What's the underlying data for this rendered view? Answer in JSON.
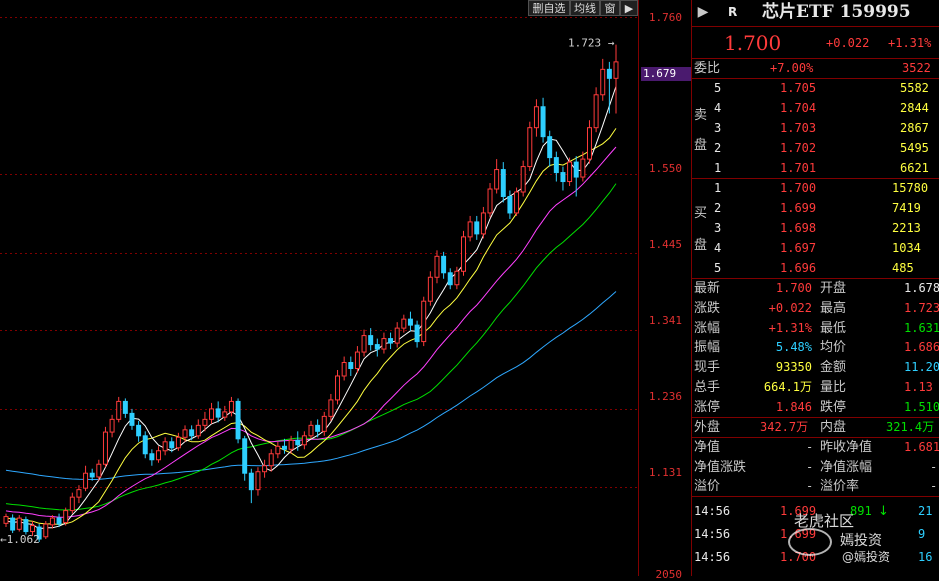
{
  "toolbar": {
    "items": [
      "删自选",
      "均线",
      "窗"
    ],
    "arrow_glyph": "▶"
  },
  "axis": {
    "price_labels": [
      "1.760",
      "1.550",
      "1.445",
      "1.341",
      "1.236",
      "1.131"
    ],
    "bottom_label": "2050",
    "current_price_tag": "1.679",
    "high_label": "1.723",
    "low_label": "1.062"
  },
  "header": {
    "r_badge": "R",
    "title": "芯片ETF 159995",
    "price": "1.700",
    "change": "+0.022",
    "change_pct": "+1.31%"
  },
  "order_book": {
    "weibi_label": "委比",
    "weibi_value": "+7.00%",
    "weibi_diff": "3522",
    "sell_label_top": "卖",
    "sell_label_bottom": "盘",
    "buy_label_top": "买",
    "buy_label_bottom": "盘",
    "sell": [
      {
        "level": "5",
        "price": "1.705",
        "vol": "5582"
      },
      {
        "level": "4",
        "price": "1.704",
        "vol": "2844"
      },
      {
        "level": "3",
        "price": "1.703",
        "vol": "2867"
      },
      {
        "level": "2",
        "price": "1.702",
        "vol": "5495"
      },
      {
        "level": "1",
        "price": "1.701",
        "vol": "6621"
      }
    ],
    "buy": [
      {
        "level": "1",
        "price": "1.700",
        "vol": "15780"
      },
      {
        "level": "2",
        "price": "1.699",
        "vol": "7419"
      },
      {
        "level": "3",
        "price": "1.698",
        "vol": "2213"
      },
      {
        "level": "4",
        "price": "1.697",
        "vol": "1034"
      },
      {
        "level": "5",
        "price": "1.696",
        "vol": "485"
      }
    ]
  },
  "stats": [
    {
      "l1": "最新",
      "v1": "1.700",
      "c1": "red",
      "l2": "开盘",
      "v2": "1.678",
      "c2": "white"
    },
    {
      "l1": "涨跌",
      "v1": "+0.022",
      "c1": "red",
      "l2": "最高",
      "v2": "1.723",
      "c2": "red"
    },
    {
      "l1": "涨幅",
      "v1": "+1.31%",
      "c1": "red",
      "l2": "最低",
      "v2": "1.631",
      "c2": "green"
    },
    {
      "l1": "振幅",
      "v1": "5.48%",
      "c1": "cyan",
      "l2": "均价",
      "v2": "1.686",
      "c2": "red"
    },
    {
      "l1": "现手",
      "v1": "93350",
      "c1": "yellow",
      "l2": "金额",
      "v2": "11.20亿",
      "c2": "cyan"
    },
    {
      "l1": "总手",
      "v1": "664.1万",
      "c1": "yellow",
      "l2": "量比",
      "v2": "1.13",
      "c2": "red"
    },
    {
      "l1": "涨停",
      "v1": "1.846",
      "c1": "red",
      "l2": "跌停",
      "v2": "1.510",
      "c2": "green"
    }
  ],
  "flow": {
    "out_label": "外盘",
    "out_value": "342.7万",
    "in_label": "内盘",
    "in_value": "321.4万"
  },
  "nav": [
    {
      "l1": "净值",
      "v1": "-",
      "l2": "昨收净值",
      "v2": "1.681"
    },
    {
      "l1": "净值涨跌",
      "v1": "-",
      "l2": "净值涨幅",
      "v2": "-"
    },
    {
      "l1": "溢价",
      "v1": "-",
      "l2": "溢价率",
      "v2": "-"
    }
  ],
  "ticks": [
    {
      "time": "14:56",
      "price": "1.699",
      "vol": "891",
      "dir": "↓",
      "extra": "21"
    },
    {
      "time": "14:56",
      "price": "1.699",
      "vol": "",
      "dir": "",
      "extra": "9"
    },
    {
      "time": "14:56",
      "price": "1.700",
      "vol": "",
      "dir": "",
      "extra": "16"
    }
  ],
  "watermark": {
    "line1": "老虎社区",
    "line2": "嫣投资",
    "line3": "@嫣投资"
  },
  "colors": {
    "up": "#ff3b3b",
    "down": "#2ecfff",
    "ma5": "#ffffff",
    "ma10": "#ffff40",
    "ma20": "#ff40ff",
    "ma30": "#00e000",
    "ma60": "#2ea8ff",
    "grid": "#800000"
  },
  "chart_data": {
    "type": "candlestick",
    "ylim": [
      1.05,
      1.76
    ],
    "candles": [
      [
        1.083,
        1.092,
        1.078,
        1.096
      ],
      [
        1.09,
        1.074,
        1.07,
        1.095
      ],
      [
        1.075,
        1.09,
        1.072,
        1.094
      ],
      [
        1.088,
        1.072,
        1.068,
        1.092
      ],
      [
        1.072,
        1.08,
        1.066,
        1.086
      ],
      [
        1.078,
        1.062,
        1.058,
        1.082
      ],
      [
        1.065,
        1.082,
        1.062,
        1.086
      ],
      [
        1.081,
        1.09,
        1.076,
        1.094
      ],
      [
        1.09,
        1.082,
        1.078,
        1.096
      ],
      [
        1.084,
        1.1,
        1.08,
        1.104
      ],
      [
        1.1,
        1.118,
        1.096,
        1.124
      ],
      [
        1.118,
        1.128,
        1.11,
        1.134
      ],
      [
        1.13,
        1.15,
        1.126,
        1.16
      ],
      [
        1.15,
        1.145,
        1.14,
        1.156
      ],
      [
        1.145,
        1.162,
        1.14,
        1.168
      ],
      [
        1.162,
        1.205,
        1.158,
        1.212
      ],
      [
        1.205,
        1.222,
        1.198,
        1.228
      ],
      [
        1.222,
        1.246,
        1.218,
        1.252
      ],
      [
        1.246,
        1.23,
        1.224,
        1.25
      ],
      [
        1.23,
        1.214,
        1.208,
        1.236
      ],
      [
        1.214,
        1.2,
        1.192,
        1.22
      ],
      [
        1.2,
        1.176,
        1.17,
        1.206
      ],
      [
        1.176,
        1.168,
        1.16,
        1.182
      ],
      [
        1.168,
        1.18,
        1.164,
        1.186
      ],
      [
        1.18,
        1.192,
        1.174,
        1.198
      ],
      [
        1.192,
        1.184,
        1.178,
        1.198
      ],
      [
        1.184,
        1.198,
        1.18,
        1.204
      ],
      [
        1.198,
        1.208,
        1.192,
        1.214
      ],
      [
        1.208,
        1.2,
        1.194,
        1.214
      ],
      [
        1.2,
        1.214,
        1.196,
        1.222
      ],
      [
        1.214,
        1.222,
        1.206,
        1.232
      ],
      [
        1.222,
        1.236,
        1.216,
        1.244
      ],
      [
        1.236,
        1.225,
        1.218,
        1.246
      ],
      [
        1.225,
        1.232,
        1.22,
        1.24
      ],
      [
        1.232,
        1.246,
        1.226,
        1.252
      ],
      [
        1.246,
        1.196,
        1.19,
        1.25
      ],
      [
        1.196,
        1.15,
        1.14,
        1.2
      ],
      [
        1.15,
        1.128,
        1.11,
        1.156
      ],
      [
        1.128,
        1.152,
        1.12,
        1.158
      ],
      [
        1.152,
        1.16,
        1.144,
        1.168
      ],
      [
        1.16,
        1.176,
        1.152,
        1.182
      ],
      [
        1.176,
        1.186,
        1.17,
        1.192
      ],
      [
        1.186,
        1.182,
        1.176,
        1.196
      ],
      [
        1.182,
        1.194,
        1.176,
        1.2
      ],
      [
        1.194,
        1.188,
        1.18,
        1.206
      ],
      [
        1.188,
        1.2,
        1.182,
        1.206
      ],
      [
        1.2,
        1.214,
        1.196,
        1.22
      ],
      [
        1.214,
        1.206,
        1.198,
        1.222
      ],
      [
        1.206,
        1.226,
        1.2,
        1.232
      ],
      [
        1.226,
        1.248,
        1.22,
        1.256
      ],
      [
        1.248,
        1.28,
        1.242,
        1.288
      ],
      [
        1.28,
        1.298,
        1.274,
        1.306
      ],
      [
        1.298,
        1.29,
        1.28,
        1.306
      ],
      [
        1.29,
        1.312,
        1.284,
        1.32
      ],
      [
        1.312,
        1.334,
        1.306,
        1.342
      ],
      [
        1.334,
        1.322,
        1.314,
        1.344
      ],
      [
        1.322,
        1.316,
        1.306,
        1.33
      ],
      [
        1.316,
        1.33,
        1.31,
        1.338
      ],
      [
        1.33,
        1.324,
        1.316,
        1.338
      ],
      [
        1.324,
        1.344,
        1.318,
        1.352
      ],
      [
        1.344,
        1.356,
        1.338,
        1.362
      ],
      [
        1.356,
        1.348,
        1.34,
        1.366
      ],
      [
        1.348,
        1.326,
        1.318,
        1.354
      ],
      [
        1.326,
        1.38,
        1.32,
        1.386
      ],
      [
        1.38,
        1.412,
        1.374,
        1.42
      ],
      [
        1.412,
        1.44,
        1.404,
        1.448
      ],
      [
        1.44,
        1.418,
        1.41,
        1.446
      ],
      [
        1.418,
        1.402,
        1.396,
        1.424
      ],
      [
        1.402,
        1.42,
        1.396,
        1.426
      ],
      [
        1.42,
        1.466,
        1.414,
        1.474
      ],
      [
        1.466,
        1.486,
        1.46,
        1.494
      ],
      [
        1.486,
        1.47,
        1.462,
        1.494
      ],
      [
        1.47,
        1.498,
        1.464,
        1.506
      ],
      [
        1.498,
        1.53,
        1.492,
        1.538
      ],
      [
        1.53,
        1.556,
        1.524,
        1.57
      ],
      [
        1.556,
        1.52,
        1.512,
        1.566
      ],
      [
        1.52,
        1.498,
        1.49,
        1.528
      ],
      [
        1.498,
        1.526,
        1.494,
        1.532
      ],
      [
        1.526,
        1.56,
        1.52,
        1.568
      ],
      [
        1.56,
        1.612,
        1.554,
        1.62
      ],
      [
        1.612,
        1.64,
        1.6,
        1.65
      ],
      [
        1.64,
        1.6,
        1.592,
        1.652
      ],
      [
        1.6,
        1.572,
        1.56,
        1.608
      ],
      [
        1.572,
        1.552,
        1.54,
        1.58
      ],
      [
        1.552,
        1.54,
        1.528,
        1.56
      ],
      [
        1.54,
        1.566,
        1.534,
        1.572
      ],
      [
        1.566,
        1.546,
        1.52,
        1.574
      ],
      [
        1.546,
        1.57,
        1.54,
        1.58
      ],
      [
        1.57,
        1.612,
        1.564,
        1.622
      ],
      [
        1.612,
        1.656,
        1.606,
        1.666
      ],
      [
        1.656,
        1.69,
        1.648,
        1.704
      ],
      [
        1.69,
        1.678,
        1.631,
        1.7
      ],
      [
        1.678,
        1.7,
        1.631,
        1.723
      ]
    ]
  }
}
